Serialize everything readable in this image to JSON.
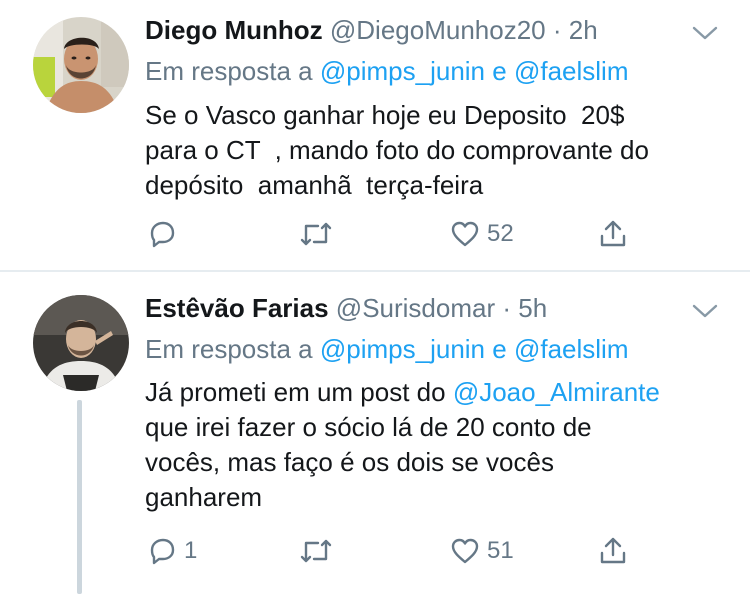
{
  "tweets": [
    {
      "name": "Diego Munhoz",
      "handle": "@DiegoMunhoz20",
      "time": "2h",
      "reply_prefix": "Em resposta a",
      "reply_to_1": "@pimps_junin",
      "reply_joiner": "e",
      "reply_to_2": "@faelslim",
      "body_before": "Se o Vasco ganhar hoje eu Deposito  20$\npara o CT  , mando foto do comprovante do\ndepósito  amanhã  terça-feira",
      "body_mention": "",
      "body_after": "",
      "reply_count": "",
      "like_count": "52"
    },
    {
      "name": "Estêvão Farias",
      "handle": "@Surisdomar",
      "time": "5h",
      "reply_prefix": "Em resposta a",
      "reply_to_1": "@pimps_junin",
      "reply_joiner": "e",
      "reply_to_2": "@faelslim",
      "body_before": "Já prometi em um post do ",
      "body_mention": "@Joao_Almirante",
      "body_after": "\nque irei fazer o sócio lá de 20 conto de\nvocês, mas faço é os dois se vocês\nganharem",
      "reply_count": "1",
      "like_count": "51"
    }
  ],
  "separator": " · ",
  "colors": {
    "accent": "#1da1f2",
    "secondary_text": "#657786",
    "thread_line": "#ccd6dd"
  },
  "icons": [
    "reply-icon",
    "retweet-icon",
    "like-icon",
    "share-icon",
    "chevron-down-icon"
  ]
}
